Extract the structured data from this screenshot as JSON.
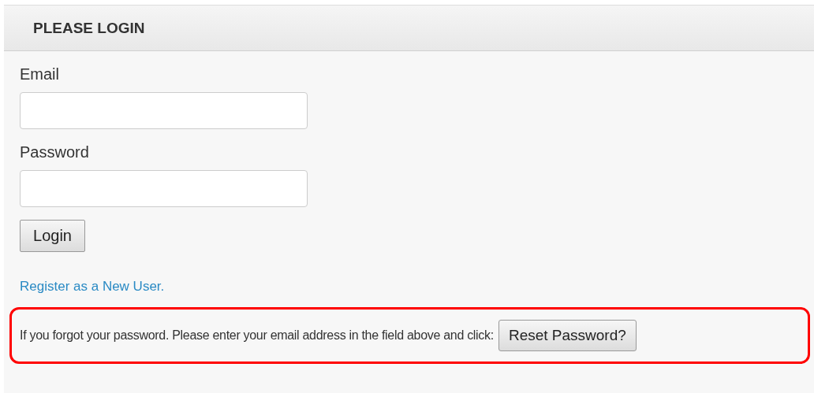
{
  "panel": {
    "title": "PLEASE LOGIN"
  },
  "fields": [
    {
      "label": "Email"
    },
    {
      "label": "Password"
    }
  ],
  "login_button": "Login",
  "register_link": "Register as a New User.",
  "reset": {
    "highlighted": true,
    "text": "If you forgot your password. Please enter your email address in the field above and click:",
    "button": "Reset Password?"
  }
}
